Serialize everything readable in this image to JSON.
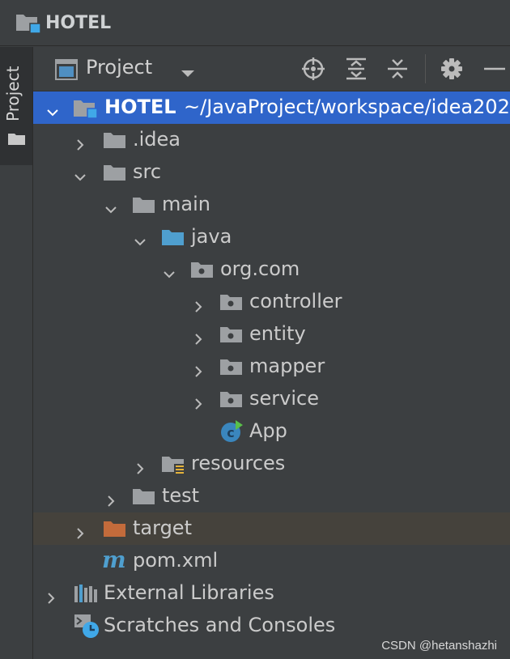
{
  "window": {
    "title": "HOTEL"
  },
  "tool_strip": {
    "tab_label": "Project"
  },
  "project_toolbar": {
    "view_label": "Project",
    "buttons": [
      "locate-icon",
      "expand-all-icon",
      "collapse-all-icon",
      "gear-icon",
      "minimize-icon"
    ]
  },
  "tree": {
    "root": {
      "name": "HOTEL",
      "path": "~/JavaProject/workspace/idea202"
    },
    "idea": ".idea",
    "src": "src",
    "main": "main",
    "java": "java",
    "org_com": "org.com",
    "controller": "controller",
    "entity": "entity",
    "mapper": "mapper",
    "service": "service",
    "app": "App",
    "resources": "resources",
    "test": "test",
    "target": "target",
    "pom": "pom.xml",
    "external_libraries": "External Libraries",
    "scratches": "Scratches and Consoles"
  },
  "colors": {
    "selection": "#2f65ca",
    "folder_gray": "#9da0a3",
    "source_blue": "#4f9fcf",
    "target_orange": "#c36b3b",
    "highlight_row": "#45423c"
  },
  "watermark": "CSDN @hetanshazhi"
}
